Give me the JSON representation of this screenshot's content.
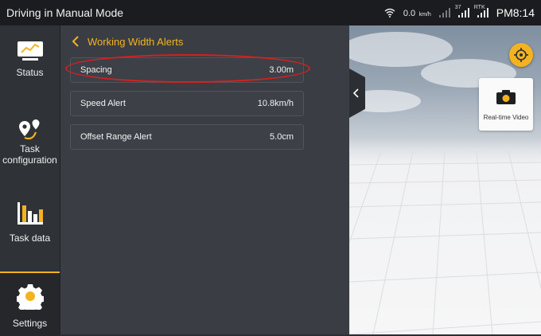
{
  "statusbar": {
    "title": "Driving in Manual Mode",
    "speed": "0.0",
    "speed_unit": "km/h",
    "sat_count": "37",
    "rtk_label": "RTK",
    "time": "PM8:14"
  },
  "sidebar": {
    "items": [
      {
        "label": "Status",
        "icon": "monitor-chart-icon",
        "active": false
      },
      {
        "label": "Task configuration",
        "icon": "route-pin-icon",
        "active": false
      },
      {
        "label": "Task data",
        "icon": "bar-chart-icon",
        "active": false
      },
      {
        "label": "Settings",
        "icon": "gear-icon",
        "active": true
      }
    ]
  },
  "panel": {
    "title": "Working Width Alerts",
    "rows": [
      {
        "label": "Spacing",
        "value": "3.00m"
      },
      {
        "label": "Speed Alert",
        "value": "10.8km/h"
      },
      {
        "label": "Offset Range Alert",
        "value": "5.0cm"
      }
    ]
  },
  "viewport": {
    "video_label": "Real-time Video"
  },
  "colors": {
    "accent": "#f3b320",
    "highlight": "#d62020"
  }
}
